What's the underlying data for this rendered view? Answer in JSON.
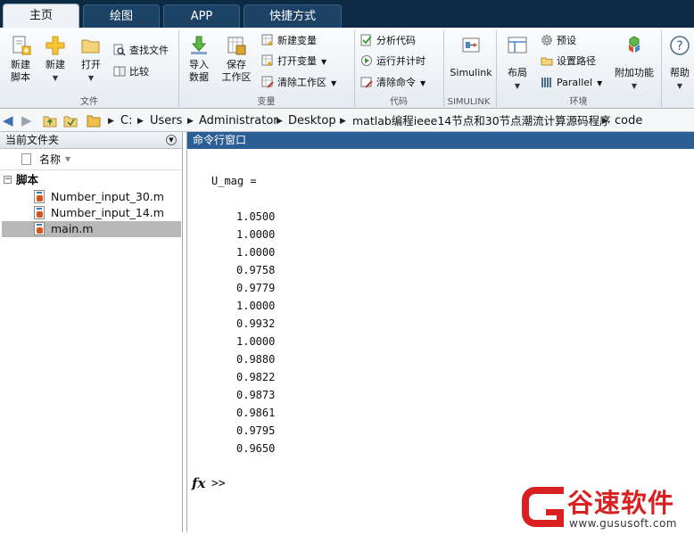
{
  "tabs": [
    "主页",
    "绘图",
    "APP",
    "快捷方式"
  ],
  "ribbon": {
    "file": {
      "new_script": "新建\n脚本",
      "new": "新建",
      "open": "打开",
      "find_files": "查找文件",
      "compare": "比较",
      "group": "文件"
    },
    "variable": {
      "import": "导入\n数据",
      "save_ws": "保存\n工作区",
      "new_var": "新建变量",
      "open_var": "打开变量",
      "clear_ws": "清除工作区",
      "group": "变量"
    },
    "code": {
      "analyze": "分析代码",
      "run_time": "运行并计时",
      "clear_cmd": "清除命令",
      "group": "代码"
    },
    "simulink": {
      "label": "Simulink",
      "group": "SIMULINK"
    },
    "env": {
      "layout": "布局",
      "prefs": "预设",
      "set_path": "设置路径",
      "parallel": "Parallel",
      "addons": "附加功能",
      "group": "环境"
    },
    "help": {
      "label": "帮助"
    }
  },
  "breadcrumb": [
    "C:",
    "Users",
    "Administrator",
    "Desktop",
    "matlab编程ieee14节点和30节点潮流计算源码程序",
    "code"
  ],
  "left_panel": {
    "title": "当前文件夹",
    "column_name": "名称",
    "folder": "脚本",
    "files": [
      "Number_input_30.m",
      "Number_input_14.m",
      "main.m"
    ],
    "selected": "main.m"
  },
  "command_window": {
    "title": "命令行窗口",
    "variable_line": "U_mag =",
    "values": [
      "1.0500",
      "1.0000",
      "1.0000",
      "0.9758",
      "0.9779",
      "1.0000",
      "0.9932",
      "1.0000",
      "0.9880",
      "0.9822",
      "0.9873",
      "0.9861",
      "0.9795",
      "0.9650"
    ],
    "fx": "fx",
    "prompt": ">>"
  },
  "watermark": {
    "brand": "谷速软件",
    "url": "www.gususoft.com",
    "color": "#d7201f"
  },
  "colors": {
    "tabbar": "#0d2a45",
    "cmd_title": "#2b5e95",
    "selection": "#b7b7b7"
  }
}
